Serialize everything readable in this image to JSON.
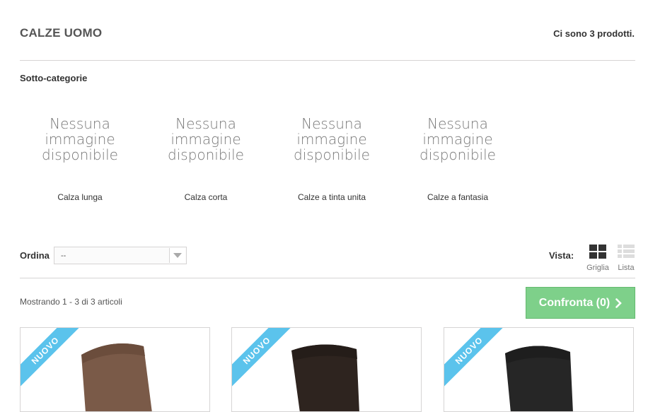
{
  "category": {
    "title": "CALZE UOMO",
    "product_count": "Ci sono 3 prodotti."
  },
  "subcategories": {
    "heading": "Sotto-categorie",
    "no_image_text": [
      "Nessuna",
      "immagine",
      "disponibile"
    ],
    "items": [
      {
        "name": "Calza lunga"
      },
      {
        "name": "Calza corta"
      },
      {
        "name": "Calze a tinta unita"
      },
      {
        "name": "Calze a fantasia"
      }
    ]
  },
  "toolbar": {
    "sort_label": "Ordina",
    "sort_value": "--",
    "view_label": "Vista:",
    "grid_label": "Griglia",
    "list_label": "Lista",
    "showing": "Mostrando 1 - 3 di 3 articoli",
    "compare_label": "Confronta (0)"
  },
  "products": [
    {
      "badge": "NUOVO",
      "color": "#7a5a48"
    },
    {
      "badge": "NUOVO",
      "color": "#2e241f"
    },
    {
      "badge": "NUOVO",
      "color": "#262626"
    }
  ],
  "colors": {
    "accent_green": "#7ed08a",
    "ribbon_blue": "#5bc3ec"
  }
}
